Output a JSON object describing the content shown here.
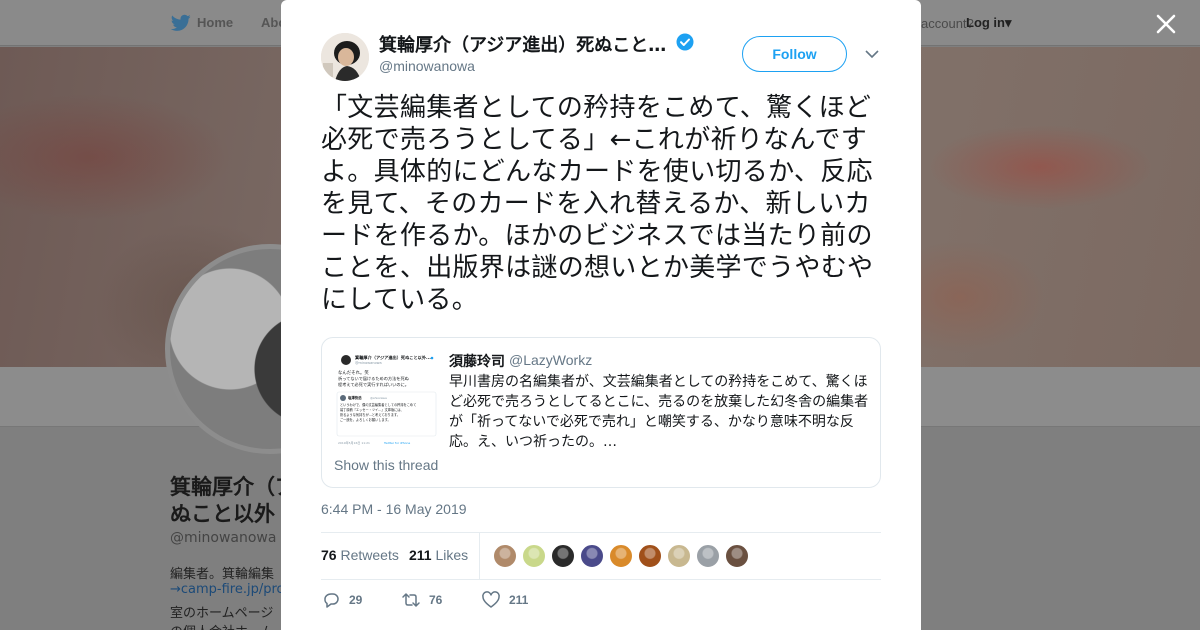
{
  "background": {
    "nav": {
      "home_label": "Home",
      "about_label": "Abo",
      "account_prompt": "account?",
      "login_label": "Log in"
    },
    "profile": {
      "name_line1": "箕輪厚介（ア",
      "name_line2": "ぬこと以外",
      "handle": "@minowanowa",
      "bio_line1": "編集者。箕輪編集",
      "bio_line2": "→camp-fire.jp/pro",
      "bio_line3": "室のホームページ",
      "bio_line4": "の個人会社ホーム"
    }
  },
  "tweet": {
    "author_name": "箕輪厚介（アジア進出）死ぬこと…",
    "author_handle": "@minowanowa",
    "follow_label": "Follow",
    "text": "「文芸編集者としての矜持をこめて、驚くほど必死で売ろうとしてる」←これが祈りなんですよ。具体的にどんなカードを使い切るか、反応を見て、そのカードを入れ替えるか、新しいカードを作るか。ほかのビジネスでは当たり前のことを、出版界は謎の想いとか美学でうやむやにしている。",
    "quoted": {
      "name": "須藤玲司",
      "handle": "@LazyWorkz",
      "text": "早川書房の名編集者が、文芸編集者としての矜持をこめて、驚くほど必死で売ろうとしてるとこに、売るのを放棄した幻冬舎の編集者が「祈ってないで必死で売れ」と嘲笑する、かなり意味不明な反応。え、いつ祈ったの。…",
      "show_thread": "Show this thread",
      "thumb": {
        "name": "箕輪厚介（アジア進出）死ぬこと以外...",
        "handle": "@minowanowa",
        "body": "なんだそれ。笑\n祈ってないで届けるための方法を死ぬ程考えて必死で実行すればいいのに。",
        "quoted_name": "塩澤快浩",
        "quoted_handle": "@shiozawa",
        "quoted_body": "というわけで、僕の文芸編集者としての矜持をこめて装丁原稿『エッセー・ツイ…』文庫版には、祈るような気持ちが…と考えております。",
        "date": "2019年5月16日 11:21",
        "via": "Twitter for iPhone"
      }
    },
    "timestamp": "6:44 PM - 16 May 2019",
    "retweets_count": "76",
    "retweets_label": "Retweets",
    "likes_count": "211",
    "likes_label": "Likes",
    "actions": {
      "replies": "29",
      "retweets": "76",
      "likes": "211"
    },
    "liker_colors": [
      "#b08a6a",
      "#c9d88a",
      "#2a2a2a",
      "#4a4a8a",
      "#d98a2a",
      "#a0501a",
      "#c8b890",
      "#9aa0a6",
      "#6a5040"
    ]
  }
}
